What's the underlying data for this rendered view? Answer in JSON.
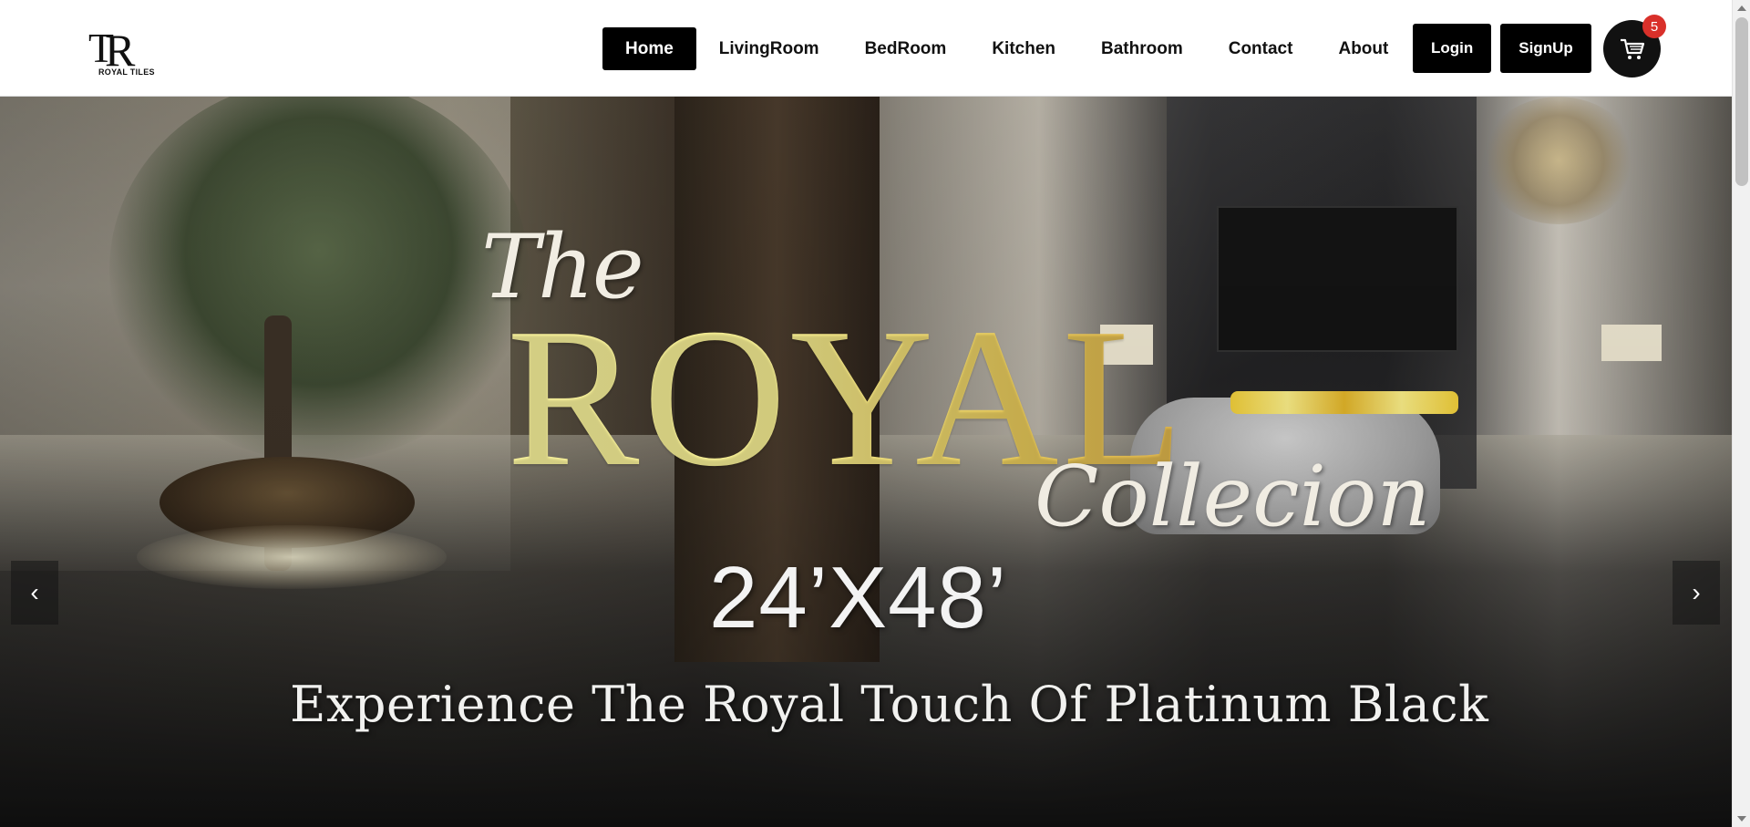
{
  "brand": {
    "logo_letters": "TR",
    "logo_text": "ROYAL TILES"
  },
  "nav": {
    "items": [
      {
        "label": "Home",
        "active": true
      },
      {
        "label": "LivingRoom",
        "active": false
      },
      {
        "label": "BedRoom",
        "active": false
      },
      {
        "label": "Kitchen",
        "active": false
      },
      {
        "label": "Bathroom",
        "active": false
      },
      {
        "label": "Contact",
        "active": false
      },
      {
        "label": "About",
        "active": false
      }
    ]
  },
  "auth": {
    "login_label": "Login",
    "signup_label": "SignUp"
  },
  "cart": {
    "icon": "cart-icon",
    "count": "5"
  },
  "hero": {
    "title_the": "The",
    "title_main": "ROYAL",
    "title_collection": "Collecion",
    "size": "24’X48’",
    "tagline": "Experience The Royal Touch Of Platinum Black"
  },
  "carousel": {
    "prev_label": "‹",
    "next_label": "›"
  },
  "colors": {
    "header_bg": "#ffffff",
    "button_bg": "#000000",
    "badge": "#d9302a",
    "gold": "#e9cb5b"
  }
}
